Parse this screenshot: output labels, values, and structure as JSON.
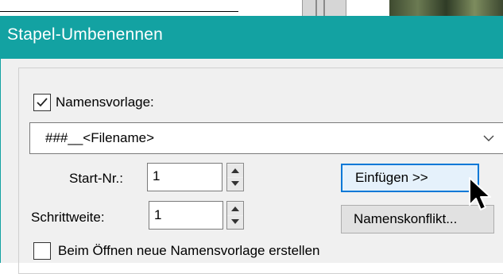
{
  "window": {
    "title": "Stapel-Umbenennen"
  },
  "name_template": {
    "checkbox_label": "Namensvorlage:",
    "checked": true,
    "combo_value": "###__<Filename>"
  },
  "start_number": {
    "label": "Start-Nr.:",
    "value": "1"
  },
  "step_width": {
    "label": "Schrittweite:",
    "value": "1"
  },
  "buttons": {
    "insert_label": "Einfügen >>",
    "conflict_label": "Namenskonflikt..."
  },
  "new_template_on_open": {
    "checkbox_label": "Beim Öffnen neue Namensvorlage erstellen",
    "checked": false
  },
  "colors": {
    "titlebar": "#13a2a2",
    "focus_border": "#0078d7",
    "dialog_background": "#f0f0f0"
  },
  "icons": [
    "checkmark-icon",
    "chevron-down-icon",
    "spin-up-icon",
    "spin-down-icon",
    "mouse-cursor-icon"
  ]
}
